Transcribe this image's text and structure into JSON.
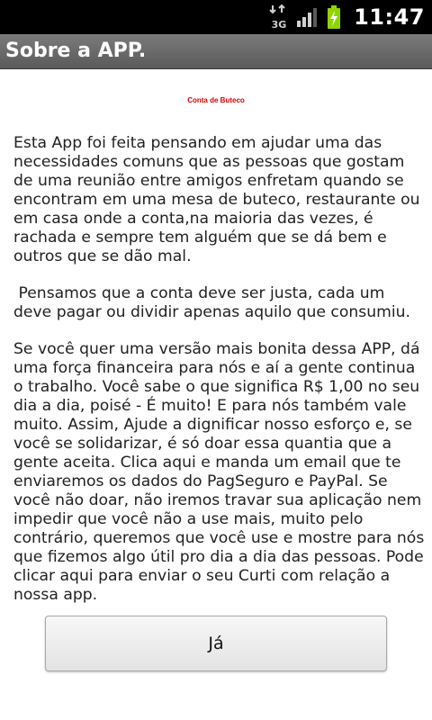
{
  "status_bar": {
    "time": "11:47",
    "network_label": "3G",
    "icons": [
      "data-arrows-icon",
      "signal-bars-icon",
      "battery-charging-icon"
    ]
  },
  "title_bar": {
    "title": "Sobre a APP."
  },
  "content": {
    "app_name": "Conta de Buteco",
    "paragraphs": [
      "Esta App foi feita pensando em ajudar uma das necessidades comuns que as pessoas que gostam de uma reunião entre amigos enfretam quando se encontram em uma mesa de buteco, restaurante ou em casa onde a conta,na maioria das vezes, é rachada e sempre tem alguém que se dá bem e outros que se dão mal.",
      " Pensamos que a conta deve ser justa, cada um deve pagar ou dividir apenas aquilo que consumiu.",
      "Se você quer uma versão mais bonita dessa APP, dá uma força financeira para nós e aí a gente continua o trabalho. Você sabe o que significa R$ 1,00 no seu dia a dia, poisé - É muito! E para nós também vale muito. Assim, Ajude a dignificar nosso esforço e, se você se solidarizar, é só doar essa quantia que a gente aceita. Clica aqui e manda um email que te enviaremos os dados do PagSeguro e PayPal. Se você não doar, não iremos travar sua aplicação nem impedir que você não a use mais, muito pelo contrário, queremos que você use e mostre para nós que fizemos algo útil pro dia a dia das pessoas. Pode clicar aqui para enviar o seu Curti com relação a nossa app."
    ]
  },
  "button": {
    "label": "Já"
  },
  "colors": {
    "status_bar_bg": "#000000",
    "title_bar_bg": "#6b6b6b",
    "battery": "#8fd400",
    "app_name": "#d40000"
  }
}
